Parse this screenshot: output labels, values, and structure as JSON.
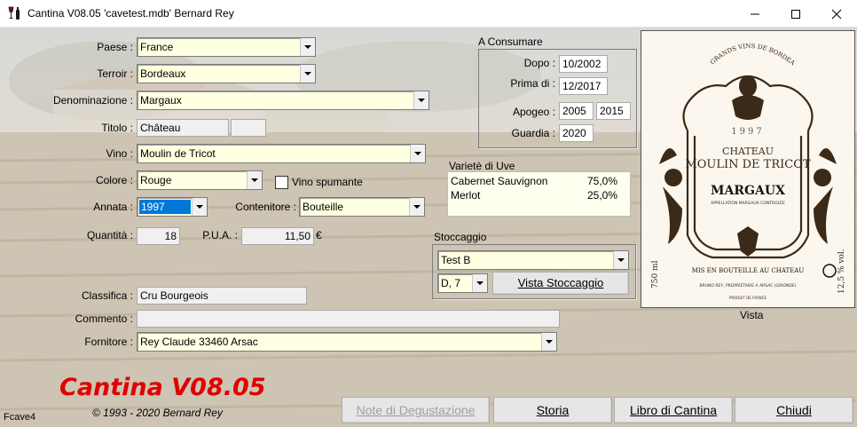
{
  "window": {
    "title": "Cantina V08.05  'cavetest.mdb'  Bernard Rey",
    "minimize_icon": "minimize-icon",
    "maximize_icon": "maximize-icon",
    "close_icon": "close-icon"
  },
  "form": {
    "paese": {
      "label": "Paese :",
      "value": "France"
    },
    "terroir": {
      "label": "Terroir :",
      "value": "Bordeaux"
    },
    "denominazione": {
      "label": "Denominazione :",
      "value": "Margaux"
    },
    "titolo": {
      "label": "Titolo :",
      "value": "Château",
      "extra": ""
    },
    "vino": {
      "label": "Vino :",
      "value": "Moulin de Tricot"
    },
    "colore": {
      "label": "Colore :",
      "value": "Rouge"
    },
    "vino_spumante": {
      "label": "Vino spumante",
      "checked": false
    },
    "annata": {
      "label": "Annata :",
      "value": "1997"
    },
    "contenitore": {
      "label": "Contenitore :",
      "value": "Bouteille"
    },
    "quantita": {
      "label": "Quantità :",
      "value": "18"
    },
    "pua": {
      "label": "P.U.A. :",
      "value": "11,50",
      "currency": "€"
    },
    "classifica": {
      "label": "Classifica :",
      "value": "Cru Bourgeois"
    },
    "commento": {
      "label": "Commento :",
      "value": ""
    },
    "fornitore": {
      "label": "Fornitore :",
      "value": "Rey Claude 33460 Arsac"
    }
  },
  "a_consumare": {
    "title": "A Consumare",
    "dopo": {
      "label": "Dopo :",
      "value": "10/2002"
    },
    "prima_di": {
      "label": "Prima di :",
      "value": "12/2017"
    },
    "apogeo": {
      "label": "Apogeo :",
      "from": "2005",
      "to": "2015"
    },
    "guardia": {
      "label": "Guardia :",
      "value": "2020"
    }
  },
  "varieta": {
    "title": "Varietè di Uve",
    "rows": [
      {
        "name": "Cabernet Sauvignon",
        "pct": "75,0%"
      },
      {
        "name": "Merlot",
        "pct": "25,0%"
      }
    ]
  },
  "stoccaggio": {
    "title": "Stoccaggio",
    "location": "Test B",
    "position": "D, 7",
    "vista_button": "Vista Stoccaggio"
  },
  "label_image": {
    "caption": "Vista",
    "arc_text": "GRANDS VINS DE BORDEAUX",
    "year": "1997",
    "chateau_line1": "CHATEAU",
    "chateau_line2": "MOULIN DE TRICOT",
    "appellation": "MARGAUX",
    "appellation_sub": "APPELLATION MARGAUX CONTROLÉE",
    "bottled": "MIS EN BOUTEILLE AU CHATEAU",
    "producer": "BRUNO REY, PROPRIÉTAIRE A ARSAC (GIRONDE)",
    "volume": "750 ml",
    "alcohol": "12,5 % vol.",
    "origin": "PRODUIT DE FRANCE"
  },
  "footer": {
    "brand": "Cantina V08.05",
    "copyright": "© 1993 - 2020 Bernard Rey",
    "form_id": "Fcave4",
    "buttons": {
      "note": "Note di Degustazione",
      "storia": "Storia",
      "libro": "Libro di Cantina",
      "chiudi": "Chiudi"
    }
  },
  "colors": {
    "input_bg": "#ffffe1",
    "brand_red": "#e00000",
    "selection_blue": "#0078d7"
  }
}
